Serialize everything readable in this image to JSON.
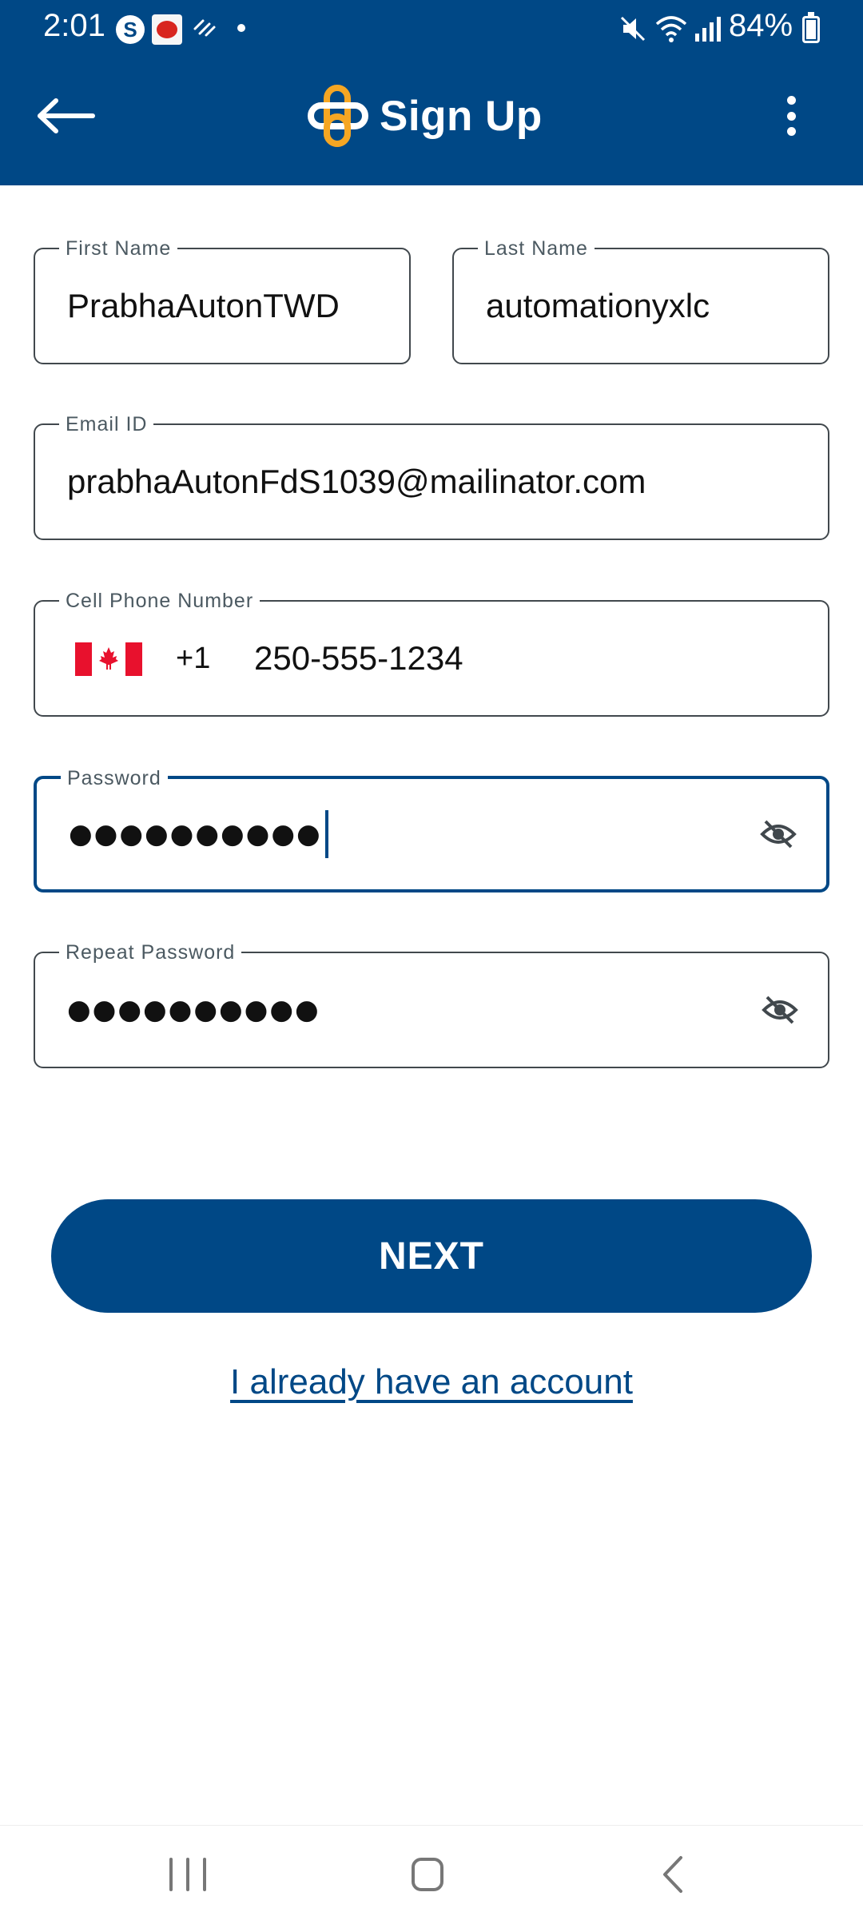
{
  "status_bar": {
    "time": "2:01",
    "s_icon_letter": "S",
    "battery": "84%"
  },
  "app_bar": {
    "title": "Sign Up",
    "brand_colors": {
      "primary": "#004886",
      "accent": "#f5a623"
    }
  },
  "form": {
    "first_name": {
      "label": "First Name",
      "value": "PrabhaAutonTWD"
    },
    "last_name": {
      "label": "Last Name",
      "value": "automationyxlc"
    },
    "email": {
      "label": "Email ID",
      "value": "prabhaAutonFdS1039@mailinator.com"
    },
    "phone": {
      "label": "Cell Phone Number",
      "country_code": "+1",
      "value": "250-555-1234",
      "flag": "canada-flag"
    },
    "password": {
      "label": "Password",
      "masked_value": "●●●●●●●●●●"
    },
    "repeat_password": {
      "label": "Repeat Password",
      "masked_value": "●●●●●●●●●●"
    }
  },
  "actions": {
    "next_label": "NEXT",
    "login_link": "I already have an account"
  }
}
